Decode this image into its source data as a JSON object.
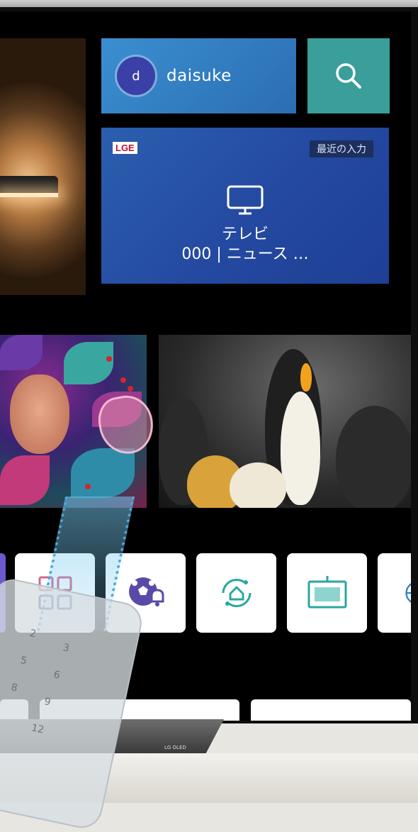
{
  "profile": {
    "avatar_initial": "d",
    "username": "daisuke"
  },
  "search": {
    "icon": "search-icon"
  },
  "input_card": {
    "brand_badge": "LGE",
    "recent_label": "最近の入力",
    "icon": "tv-icon",
    "title": "テレビ",
    "subtitle": "000 | ニュース …"
  },
  "apps": [
    {
      "name": "apps-grid",
      "icon": "grid-icon"
    },
    {
      "name": "sports",
      "icon": "soccer-ball-bell-icon"
    },
    {
      "name": "home-dashboard",
      "icon": "home-circle-icon"
    },
    {
      "name": "screen-share",
      "icon": "screen-icon"
    },
    {
      "name": "internet",
      "icon": "globe-icon"
    }
  ],
  "stand_brand": "LG OLED",
  "colors": {
    "profile_card": "#2f78bf",
    "avatar": "#3b3fa8",
    "search_card": "#3a9e9a",
    "input_card": "#2449a0",
    "lge_red": "#c0132a",
    "icon_teal": "#2aa7a1",
    "icon_purple": "#5a4aa8"
  }
}
